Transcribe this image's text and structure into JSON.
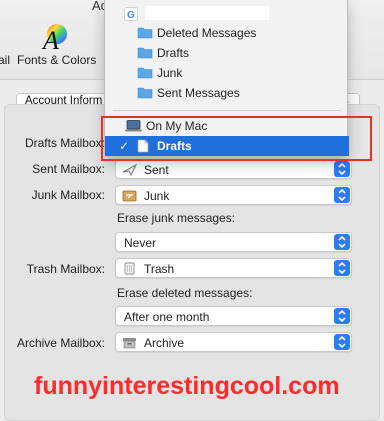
{
  "window": {
    "title": "Ac"
  },
  "toolbar": {
    "left_label": "ail",
    "fonts_label": "Fonts & Colors"
  },
  "tabs": {
    "account_info": "Account Inform",
    "right_fragment": "s"
  },
  "mailboxes": {
    "drafts_label": "Drafts Mailbox:",
    "sent_label": "Sent Mailbox:",
    "sent_value": "Sent",
    "junk_label": "Junk Mailbox:",
    "junk_value": "Junk",
    "erase_junk_label": "Erase junk messages:",
    "erase_junk_value": "Never",
    "trash_label": "Trash Mailbox:",
    "trash_value": "Trash",
    "erase_deleted_label": "Erase deleted messages:",
    "erase_deleted_value": "After one month",
    "archive_label": "Archive Mailbox:",
    "archive_value": "Archive"
  },
  "dropdown": {
    "account_icon": "google-icon",
    "folders": [
      "Deleted Messages",
      "Drafts",
      "Junk",
      "Sent Messages"
    ],
    "on_my_mac": "On My Mac",
    "selected": "Drafts",
    "checkmark": "✓"
  },
  "watermark": "funnyinterestingcool.com",
  "colors": {
    "accent": "#1f6fdc",
    "stepper": "#2d7cf6",
    "highlight": "#e33226",
    "watermark": "#ff2a2a",
    "folder": "#5aa7e8"
  }
}
